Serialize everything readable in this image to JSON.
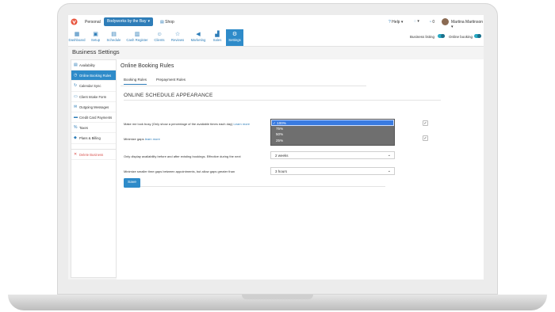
{
  "topbar": {
    "personal": "Personal",
    "business": "Bodyworks by the Bay",
    "shop": "Shop",
    "help": "Help",
    "notifications": "0",
    "user": "Martina Martinson"
  },
  "nav": [
    {
      "label": "Dashboard",
      "icon": "dashboard-icon"
    },
    {
      "label": "Setup",
      "icon": "setup-icon"
    },
    {
      "label": "Schedule",
      "icon": "calendar-icon"
    },
    {
      "label": "Cash Register",
      "icon": "register-icon"
    },
    {
      "label": "Clients",
      "icon": "clients-icon"
    },
    {
      "label": "Reviews",
      "icon": "star-icon"
    },
    {
      "label": "Marketing",
      "icon": "megaphone-icon"
    },
    {
      "label": "Sales",
      "icon": "chart-icon"
    },
    {
      "label": "Settings",
      "icon": "gear-icon"
    }
  ],
  "toggles": {
    "business_listing": "Business listing",
    "online_booking": "Online booking"
  },
  "page_title": "Business Settings",
  "sidebar": [
    "Availability",
    "Online Booking Rules",
    "Calendar Sync",
    "Client Intake Form",
    "Outgoing Messages",
    "Credit Card Payments",
    "Taxes",
    "Plans & Billing",
    "Delete Business"
  ],
  "main": {
    "title": "Online Booking Rules",
    "tabs": [
      "Booking Rules",
      "Prepayment Rules"
    ],
    "section_title": "ONLINE SCHEDULE APPEARANCE",
    "rows": {
      "busy_label": "Make me look busy (Only show a percentage of the available times each day)",
      "busy_link": "Learn more",
      "gaps_label": "Minimize gaps",
      "gaps_link": "learn more",
      "delay_label": "Only display availability before and after existing bookings. Effective during the next",
      "delay_value": "2 weeks",
      "smaller_label": "Minimize smaller time gaps between appointments, but allow gaps greater than",
      "smaller_value": "3 hours"
    },
    "busy_options": [
      "100%",
      "75%",
      "50%",
      "25%"
    ],
    "busy_selected": "100%",
    "save": "Save"
  }
}
